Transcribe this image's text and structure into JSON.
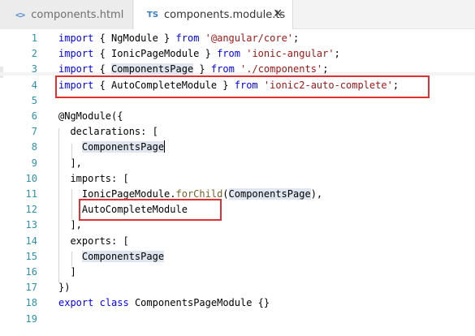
{
  "tabs": [
    {
      "icon": "<>",
      "label": "components.html"
    },
    {
      "icon": "TS",
      "label": "components.module.ts",
      "close": "✕"
    }
  ],
  "lines": [
    {
      "n": "1",
      "tokens": [
        [
          "kw",
          "import"
        ],
        [
          "plain",
          " { NgModule } "
        ],
        [
          "kw",
          "from"
        ],
        [
          "plain",
          " "
        ],
        [
          "str",
          "'@angular/core'"
        ],
        [
          "plain",
          ";"
        ]
      ]
    },
    {
      "n": "2",
      "tokens": [
        [
          "kw",
          "import"
        ],
        [
          "plain",
          " { IonicPageModule } "
        ],
        [
          "kw",
          "from"
        ],
        [
          "plain",
          " "
        ],
        [
          "str",
          "'ionic-angular'"
        ],
        [
          "plain",
          ";"
        ]
      ]
    },
    {
      "n": "3",
      "tokens": [
        [
          "kw",
          "import"
        ],
        [
          "plain",
          " { "
        ],
        [
          "hl",
          "ComponentsPage"
        ],
        [
          "plain",
          " } "
        ],
        [
          "kw",
          "from"
        ],
        [
          "plain",
          " "
        ],
        [
          "str",
          "'./components'"
        ],
        [
          "plain",
          ";"
        ]
      ]
    },
    {
      "n": "4",
      "tokens": [
        [
          "kw",
          "import"
        ],
        [
          "plain",
          " { AutoCompleteModule } "
        ],
        [
          "kw",
          "from"
        ],
        [
          "plain",
          " "
        ],
        [
          "str",
          "'ionic2-auto-complete'"
        ],
        [
          "plain",
          ";"
        ]
      ]
    },
    {
      "n": "5",
      "tokens": []
    },
    {
      "n": "6",
      "tokens": [
        [
          "plain",
          "@NgModule({"
        ]
      ]
    },
    {
      "n": "7",
      "tokens": [
        [
          "plain",
          "  declarations: ["
        ]
      ]
    },
    {
      "n": "8",
      "tokens": [
        [
          "plain",
          "    "
        ],
        [
          "hl",
          "ComponentsPage"
        ],
        [
          "cursor",
          ""
        ]
      ]
    },
    {
      "n": "9",
      "tokens": [
        [
          "plain",
          "  ],"
        ]
      ]
    },
    {
      "n": "10",
      "tokens": [
        [
          "plain",
          "  imports: ["
        ]
      ]
    },
    {
      "n": "11",
      "tokens": [
        [
          "plain",
          "    IonicPageModule."
        ],
        [
          "fn",
          "forChild"
        ],
        [
          "plain",
          "("
        ],
        [
          "hl",
          "ComponentsPage"
        ],
        [
          "plain",
          "),"
        ]
      ]
    },
    {
      "n": "12",
      "tokens": [
        [
          "plain",
          "    AutoCompleteModule"
        ]
      ]
    },
    {
      "n": "13",
      "tokens": [
        [
          "plain",
          "  ],"
        ]
      ]
    },
    {
      "n": "14",
      "tokens": [
        [
          "plain",
          "  exports: ["
        ]
      ]
    },
    {
      "n": "15",
      "tokens": [
        [
          "plain",
          "    "
        ],
        [
          "hl",
          "ComponentsPage"
        ]
      ]
    },
    {
      "n": "16",
      "tokens": [
        [
          "plain",
          "  ]"
        ]
      ]
    },
    {
      "n": "17",
      "tokens": [
        [
          "plain",
          "})"
        ]
      ]
    },
    {
      "n": "18",
      "tokens": [
        [
          "kw",
          "export"
        ],
        [
          "plain",
          " "
        ],
        [
          "kw",
          "class"
        ],
        [
          "plain",
          " ComponentsPageModule {}"
        ]
      ]
    },
    {
      "n": "19",
      "tokens": []
    }
  ]
}
